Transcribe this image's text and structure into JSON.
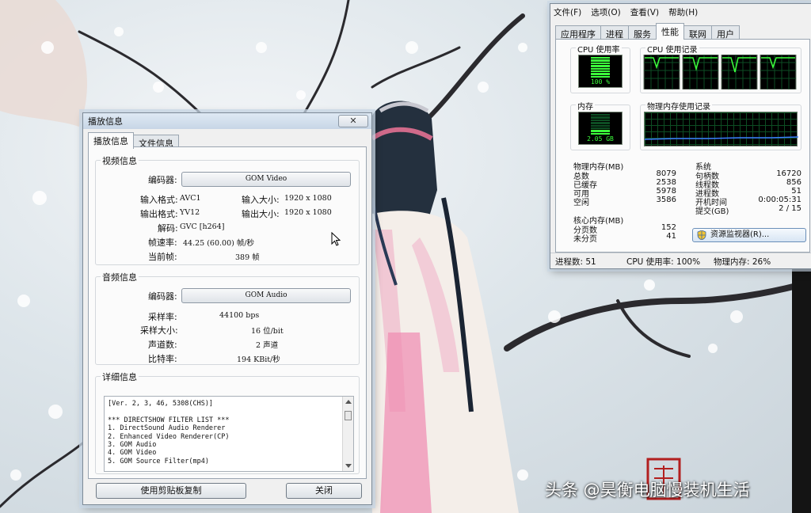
{
  "playback": {
    "title": "播放信息",
    "close": "✕",
    "tabs": [
      "播放信息",
      "文件信息"
    ],
    "video": {
      "title": "视频信息",
      "codec_label": "编码器:",
      "codec_value": "GOM Video",
      "input_format_label": "输入格式:",
      "input_format": "AVC1",
      "input_size_label": "输入大小:",
      "input_size": "1920 x 1080",
      "output_format_label": "输出格式:",
      "output_format": "YV12",
      "output_size_label": "输出大小:",
      "output_size": "1920 x 1080",
      "decode_label": "解码:",
      "decode_value": "GVC [h264]",
      "framerate_label": "帧速率:",
      "framerate_value": "44.25 (60.00) 帧/秒",
      "current_frame_label": "当前帧:",
      "current_frame_value": "389 帧"
    },
    "audio": {
      "title": "音频信息",
      "codec_label": "编码器:",
      "codec_value": "GOM Audio",
      "sample_rate_label": "采样率:",
      "sample_rate_value": "44100 bps",
      "sample_size_label": "采样大小:",
      "sample_size_value": "16 位/bit",
      "channels_label": "声道数:",
      "channels_value": "2 声道",
      "bitrate_label": "比特率:",
      "bitrate_value": "194 KBit/秒"
    },
    "detail": {
      "title": "详细信息",
      "lines": [
        "[Ver. 2, 3, 46, 5308(CHS)]",
        "",
        "*** DIRECTSHOW FILTER LIST ***",
        "1. DirectSound Audio Renderer",
        "2. Enhanced Video Renderer(CP)",
        "3. GOM Audio",
        "4. GOM Video",
        "5. GOM Source Filter(mp4)"
      ]
    },
    "copy_button": "使用剪贴板复制",
    "close_button": "关闭"
  },
  "taskmgr": {
    "menu": [
      "文件(F)",
      "选项(O)",
      "查看(V)",
      "帮助(H)"
    ],
    "tabs": [
      "应用程序",
      "进程",
      "服务",
      "性能",
      "联网",
      "用户"
    ],
    "active_tab": 3,
    "cpu_usage_title": "CPU 使用率",
    "cpu_usage_value": "100 %",
    "cpu_usage_level": 1.0,
    "cpu_history_title": "CPU 使用记录",
    "memory_title": "内存",
    "memory_value": "2.05 GB",
    "memory_level": 0.26,
    "memory_history_title": "物理内存使用记录",
    "physical_memory": {
      "title": "物理内存(MB)",
      "rows": [
        {
          "k": "总数",
          "v": "8079"
        },
        {
          "k": "已缓存",
          "v": "2538"
        },
        {
          "k": "可用",
          "v": "5978"
        },
        {
          "k": "空闲",
          "v": "3586"
        }
      ]
    },
    "system": {
      "title": "系统",
      "rows": [
        {
          "k": "句柄数",
          "v": "16720"
        },
        {
          "k": "线程数",
          "v": "856"
        },
        {
          "k": "进程数",
          "v": "51"
        },
        {
          "k": "开机时间",
          "v": "0:00:05:31"
        },
        {
          "k": "提交(GB)",
          "v": "2 / 15"
        }
      ]
    },
    "kernel_memory": {
      "title": "核心内存(MB)",
      "rows": [
        {
          "k": "分页数",
          "v": "152"
        },
        {
          "k": "未分页",
          "v": "41"
        }
      ]
    },
    "resource_monitor_button": "资源监视器(R)...",
    "status": {
      "processes": "进程数: 51",
      "cpu": "CPU 使用率: 100%",
      "memory": "物理内存: 26%"
    }
  },
  "watermark": "头条 @昊衡电脑慢装机生活",
  "colors": {
    "meter_green": "#3cff3c",
    "graph_grid": "#0d4d23",
    "memory_line": "#3a7dff"
  }
}
